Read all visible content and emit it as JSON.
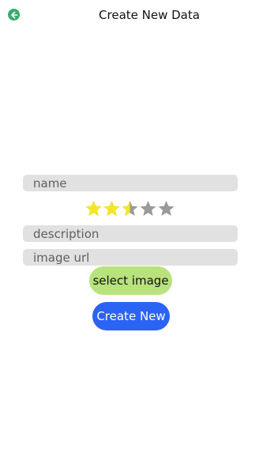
{
  "header": {
    "title": "Create New Data",
    "back_icon": "arrow-left-circle-icon",
    "accent": "#3aaa6e"
  },
  "form": {
    "name": {
      "placeholder": "name",
      "value": ""
    },
    "rating": {
      "value": 2.5,
      "max": 5,
      "filled_color": "#f5e625",
      "empty_color": "#9a9a9a"
    },
    "description": {
      "placeholder": "description",
      "value": ""
    },
    "image_url": {
      "placeholder": "image url",
      "value": ""
    }
  },
  "buttons": {
    "select_image": {
      "label": "select image",
      "color": "#b8e27c"
    },
    "create_new": {
      "label": "Create New",
      "color": "#2b63f5"
    }
  }
}
